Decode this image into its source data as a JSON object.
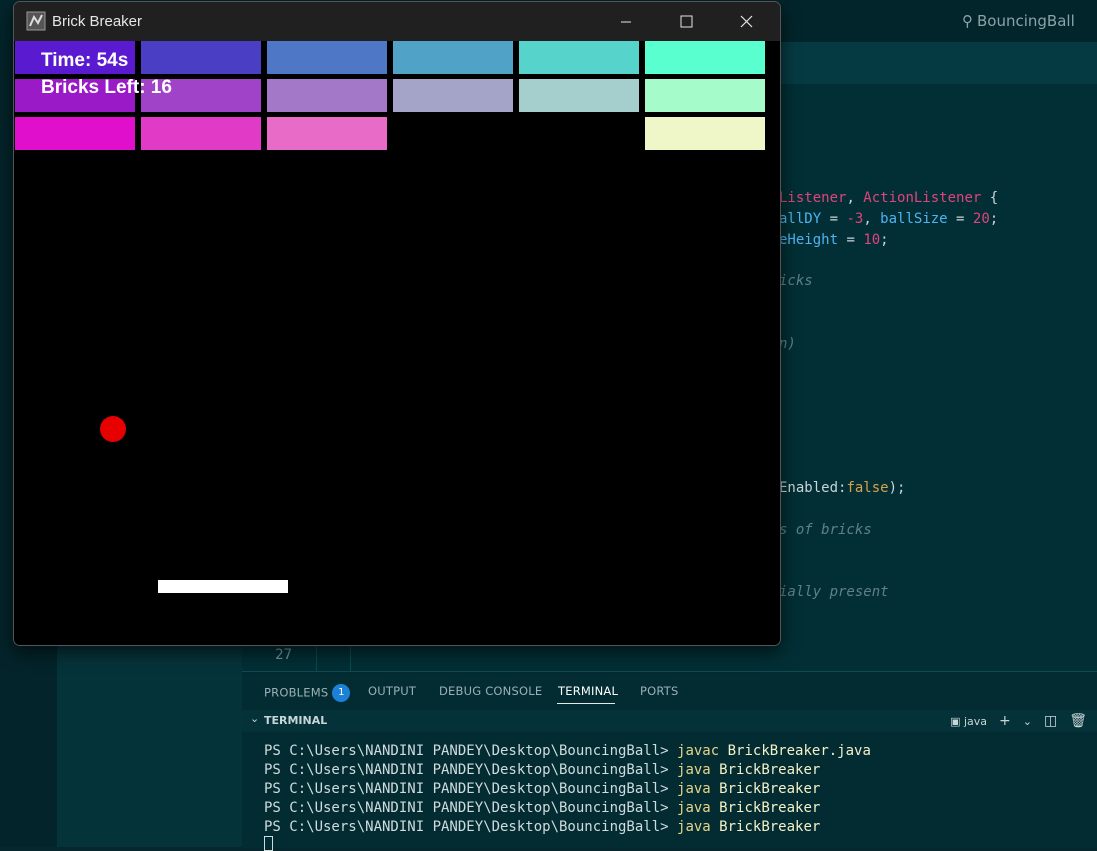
{
  "vscode": {
    "search_text": "BouncingBall",
    "code_fragments": {
      "line1_a": "Listener",
      "line1_b": ", ",
      "line1_c": "ActionListener",
      "line1_d": " {",
      "line2_a": "allDY",
      "line2_b": " = ",
      "line2_c": "-3",
      "line2_d": ", ",
      "line2_e": "ballSize",
      "line2_f": " = ",
      "line2_g": "20",
      "line2_h": ";",
      "line3_a": "eHeight",
      "line3_b": " = ",
      "line3_c": "10",
      "line3_d": ";",
      "line4": "icks",
      "line5": "n)",
      "line6_a": "Enabled:",
      "line6_b": "false",
      "line6_c": ");",
      "line7": "s of bricks",
      "line8": "ially present"
    },
    "visible_line_number": "27",
    "panel": {
      "tabs": {
        "problems": "PROBLEMS",
        "problems_count": "1",
        "output": "OUTPUT",
        "debug_console": "DEBUG CONSOLE",
        "terminal": "TERMINAL",
        "ports": "PORTS"
      },
      "terminal_header": "TERMINAL",
      "terminal_shell": "java",
      "terminal_lines": [
        {
          "prompt": "PS C:\\Users\\NANDINI PANDEY\\Desktop\\BouncingBall> ",
          "cmd": "javac",
          "arg": "BrickBreaker.java"
        },
        {
          "prompt": "PS C:\\Users\\NANDINI PANDEY\\Desktop\\BouncingBall> ",
          "cmd": "java",
          "arg": "BrickBreaker"
        },
        {
          "prompt": "PS C:\\Users\\NANDINI PANDEY\\Desktop\\BouncingBall> ",
          "cmd": "java",
          "arg": "BrickBreaker"
        },
        {
          "prompt": "PS C:\\Users\\NANDINI PANDEY\\Desktop\\BouncingBall> ",
          "cmd": "java",
          "arg": "BrickBreaker"
        },
        {
          "prompt": "PS C:\\Users\\NANDINI PANDEY\\Desktop\\BouncingBall> ",
          "cmd": "java",
          "arg": "BrickBreaker"
        }
      ]
    }
  },
  "game": {
    "window_title": "Brick Breaker",
    "hud": {
      "time_label": "Time: 54s",
      "bricks_left_label": "Bricks Left: 16"
    },
    "ball_color": "#e60000",
    "paddle_color": "#ffffff",
    "brick_grid": {
      "rows": 3,
      "cols": 6,
      "bricks": [
        {
          "row": 0,
          "col": 0,
          "color": "#5a1ad0"
        },
        {
          "row": 0,
          "col": 1,
          "color": "#4a3fc4"
        },
        {
          "row": 0,
          "col": 2,
          "color": "#4e78c6"
        },
        {
          "row": 0,
          "col": 3,
          "color": "#50a2c7"
        },
        {
          "row": 0,
          "col": 4,
          "color": "#56d4cc"
        },
        {
          "row": 0,
          "col": 5,
          "color": "#5affcf"
        },
        {
          "row": 1,
          "col": 0,
          "color": "#9a1ac8"
        },
        {
          "row": 1,
          "col": 1,
          "color": "#a043c8"
        },
        {
          "row": 1,
          "col": 2,
          "color": "#a378c9"
        },
        {
          "row": 1,
          "col": 3,
          "color": "#a4a4c8"
        },
        {
          "row": 1,
          "col": 4,
          "color": "#a4cfcc"
        },
        {
          "row": 1,
          "col": 5,
          "color": "#a6fbcb"
        },
        {
          "row": 2,
          "col": 0,
          "color": "#df0fcc"
        },
        {
          "row": 2,
          "col": 1,
          "color": "#e03ac6"
        },
        {
          "row": 2,
          "col": 2,
          "color": "#e86bc8"
        },
        {
          "row": 2,
          "col": 5,
          "color": "#eff7c9"
        }
      ]
    }
  }
}
